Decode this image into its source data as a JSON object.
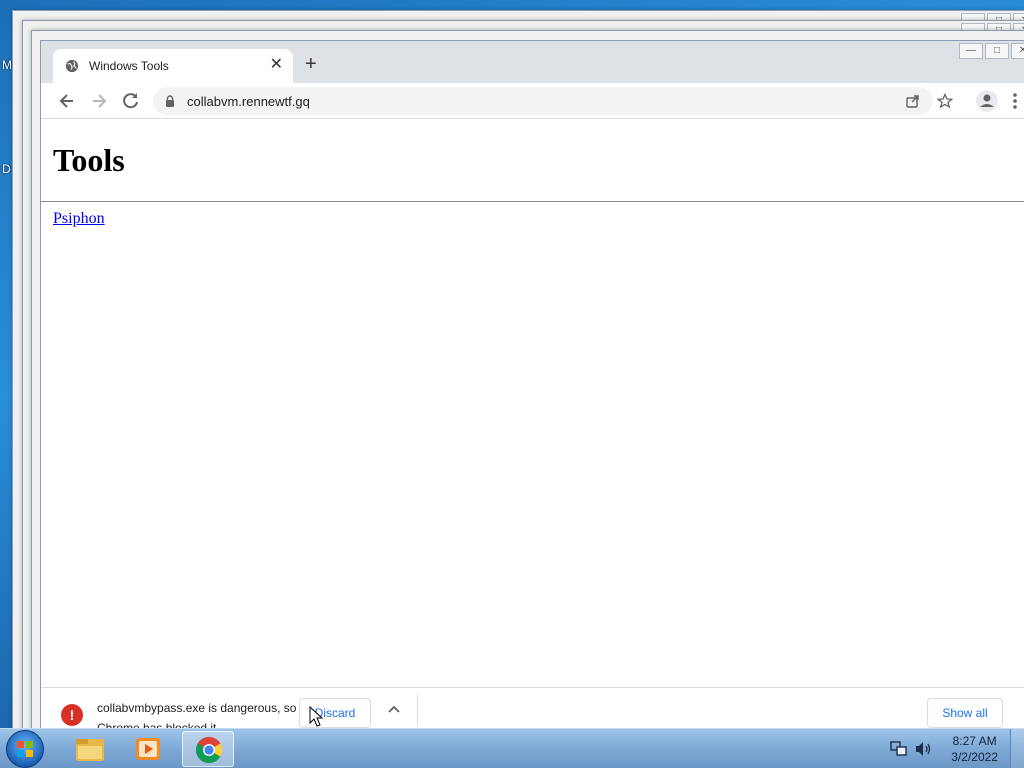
{
  "desktop": {
    "edge_labels": [
      "M",
      "D"
    ]
  },
  "background_windows": {
    "buttons": [
      "—",
      "□",
      "✕"
    ]
  },
  "browser": {
    "tab": {
      "title": "Windows Tools",
      "close": "✕"
    },
    "new_tab": "+",
    "window_buttons": [
      "—",
      "□",
      "✕"
    ],
    "omnibox": {
      "url": "collabvm.rennewtf.gq"
    }
  },
  "page": {
    "heading": "Tools",
    "link": "Psiphon"
  },
  "download_bar": {
    "warning_symbol": "!",
    "message": "collabvmbypass.exe is dangerous, so Chrome has blocked it",
    "discard_label": "Discard",
    "show_all_label": "Show all",
    "close": "✕"
  },
  "taskbar": {
    "apps": [
      "windows-explorer",
      "media-player",
      "google-chrome"
    ],
    "active_app": "google-chrome",
    "clock": {
      "time": "8:27 AM",
      "date": "3/2/2022"
    }
  },
  "colors": {
    "link": "#0000ee",
    "danger": "#d93025",
    "accent": "#1a73e8",
    "tabstrip": "#dee1e6"
  }
}
